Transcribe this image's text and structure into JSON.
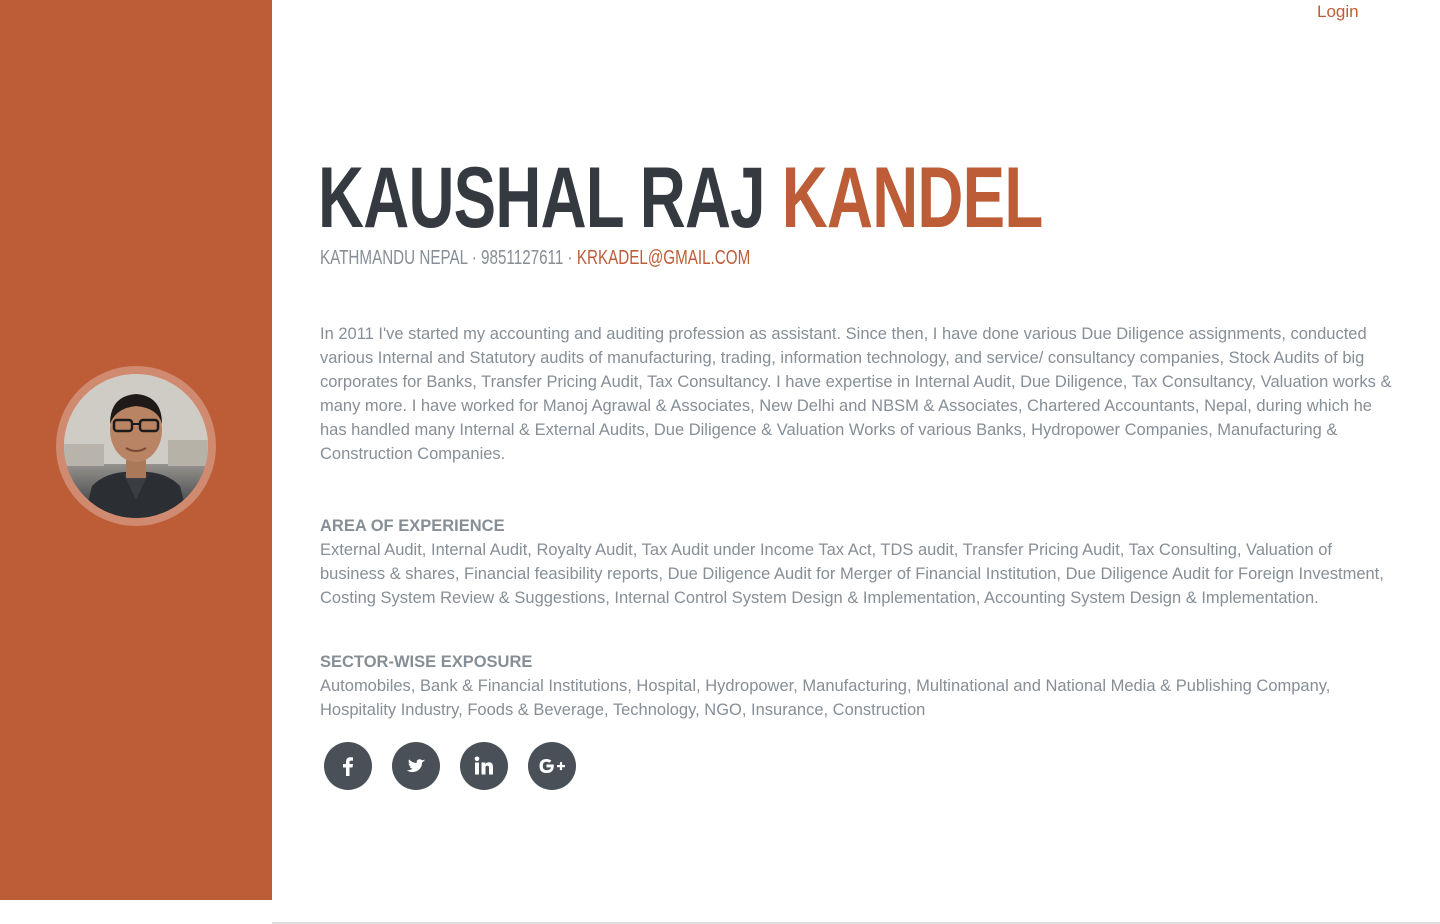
{
  "nav": {
    "login_label": "Login"
  },
  "profile": {
    "first_name": "Kaushal Raj",
    "last_name": "Kandel",
    "location": "Kathmandu Nepal",
    "phone": "9851127611",
    "separator": "·",
    "email": "krkadel@gmail.com",
    "avatar_alt": "profile-photo"
  },
  "about": {
    "bio": "In 2011 I've started my accounting and auditing profession as assistant. Since then, I have done various Due Diligence assignments, conducted various Internal and Statutory audits of manufacturing, trading, information technology, and service/ consultancy companies, Stock Audits of big corporates for Banks, Transfer Pricing Audit, Tax Consultancy. I have expertise in Internal Audit, Due Diligence, Tax Consultancy, Valuation works & many more. I have worked for Manoj Agrawal & Associates, New Delhi and NBSM & Associates, Chartered Accountants, Nepal, during which he has handled many Internal & External Audits, Due Diligence & Valuation Works of various Banks, Hydropower Companies, Manufacturing & Construction Companies."
  },
  "sections": [
    {
      "title": "Area of Experience",
      "body": "External Audit, Internal Audit, Royalty Audit, Tax Audit under Income Tax Act, TDS audit, Transfer Pricing Audit, Tax Consulting, Valuation of business & shares, Financial feasibility reports, Due Diligence Audit for Merger of Financial Institution, Due Diligence Audit for Foreign Investment, Costing System Review & Suggestions, Internal Control System Design & Implementation, Accounting System Design & Implementation."
    },
    {
      "title": "Sector-wise Exposure",
      "body": "Automobiles, Bank & Financial Institutions, Hospital, Hydropower, Manufacturing, Multinational and National Media & Publishing Company, Hospitality Industry, Foods & Beverage, Technology, NGO, Insurance, Construction"
    }
  ],
  "social": [
    {
      "icon": "facebook-icon"
    },
    {
      "icon": "twitter-icon"
    },
    {
      "icon": "linkedin-icon"
    },
    {
      "icon": "google-plus-icon"
    }
  ],
  "colors": {
    "primary": "#bd5d38",
    "heading": "#343a40",
    "text": "#868e96",
    "social_bg": "#495057"
  }
}
